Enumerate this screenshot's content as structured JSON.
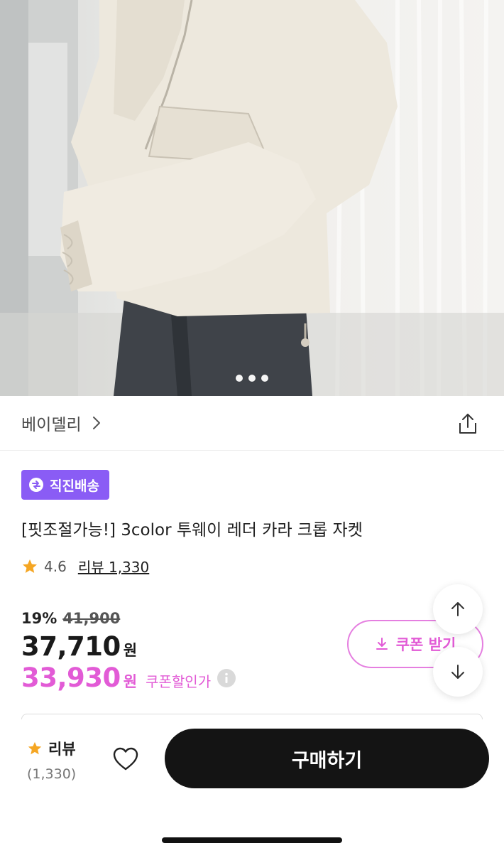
{
  "hero": {
    "image_alt": "",
    "pager_dots": 3
  },
  "brand": {
    "name": "베이델리",
    "chevron_icon": "chevron-right-icon",
    "share_icon": "share-icon"
  },
  "badge": {
    "label": "직진배송",
    "icon": "direct-shipping-icon",
    "color": "#8a5cf5"
  },
  "product": {
    "title": "[핏조절가능!] 3color 투웨이 레더 카라 크롭 자켓",
    "rating": "4.6",
    "review_link": "리뷰 1,330"
  },
  "price": {
    "discount_percent": "19%",
    "original_price": "41,900",
    "sale_price": "37,710",
    "currency": "원",
    "coupon_price": "33,930",
    "coupon_currency": "원",
    "coupon_label": "쿠폰할인가",
    "accent_color": "#e25bd6"
  },
  "coupon_button": {
    "label": "쿠폰 받기"
  },
  "bottom_bar": {
    "review_label": "리뷰",
    "review_count": "(1,330)",
    "buy_label": "구매하기"
  }
}
